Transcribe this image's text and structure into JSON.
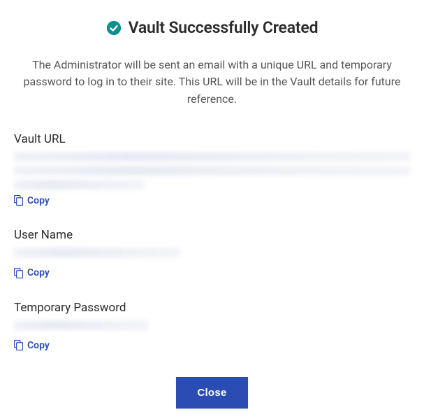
{
  "header": {
    "title": "Vault Successfully Created",
    "icon": "check-circle"
  },
  "description": "The Administrator will be sent an email with a unique URL and temporary password to log in to their site. This URL will be in the Vault details for future reference.",
  "fields": {
    "vault_url": {
      "label": "Vault URL",
      "value": "",
      "copy_label": "Copy"
    },
    "user_name": {
      "label": "User Name",
      "value": "",
      "copy_label": "Copy"
    },
    "temporary_password": {
      "label": "Temporary Password",
      "value": "",
      "copy_label": "Copy"
    }
  },
  "footer": {
    "close_label": "Close"
  },
  "colors": {
    "accent": "#2a4cb3",
    "success": "#0f8e8e"
  }
}
